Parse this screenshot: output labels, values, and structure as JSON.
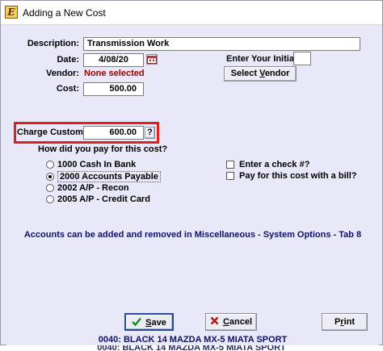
{
  "window": {
    "title": "Adding a New Cost",
    "icon": "E"
  },
  "form": {
    "description_label": "Description:",
    "description_value": "Transmission Work",
    "date_label": "Date:",
    "date_value": "4/08/20",
    "vendor_label": "Vendor:",
    "vendor_value": "None selected",
    "cost_label": "Cost:",
    "cost_value": "500.00",
    "initials_label": "Enter Your Initials:",
    "initials_value": "",
    "select_vendor_pre": "Select ",
    "select_vendor_accel": "V",
    "select_vendor_post": "endor",
    "charge_label": "Charge Customer:",
    "charge_value": "600.00",
    "help_label": "?"
  },
  "payment": {
    "question": "How did you pay for this cost?",
    "options": [
      {
        "label": "1000 Cash In Bank",
        "checked": false
      },
      {
        "label": "2000 Accounts Payable",
        "checked": true
      },
      {
        "label": "2002 A/P - Recon",
        "checked": false
      },
      {
        "label": "2005 A/P - Credit Card",
        "checked": false
      }
    ],
    "checks": [
      {
        "label": "Enter a check #?",
        "checked": false
      },
      {
        "label": "Pay for this cost with a bill?",
        "checked": false
      }
    ]
  },
  "info": "Accounts can be added and removed in Miscellaneous - System Options - Tab 8",
  "buttons": {
    "save_accel": "S",
    "save_rest": "ave",
    "cancel_accel": "C",
    "cancel_rest": "ancel",
    "print_pre": "P",
    "print_accel": "r",
    "print_post": "int"
  },
  "footer": "0040: BLACK 14 MAZDA MX-5 MIATA SPORT",
  "colors": {
    "highlight": "#e02020",
    "vendor_none": "#a00000",
    "footer_text": "#10106a",
    "save_check": "#1a8a1a",
    "cancel_x": "#c01010"
  },
  "icons": [
    "app-icon",
    "calendar-icon",
    "checkmark-icon",
    "x-icon"
  ]
}
